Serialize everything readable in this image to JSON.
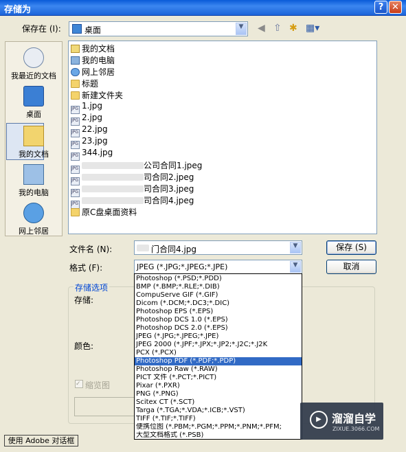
{
  "window": {
    "title": "存储为",
    "help": "?",
    "close": "✕"
  },
  "save_in": {
    "label": "保存在 (I):",
    "value": "桌面"
  },
  "toolbar": {
    "back": "◀",
    "up": "⇧",
    "new_folder": "✱",
    "views": "▦▾"
  },
  "places": [
    {
      "label": "我最近的文档",
      "icon": "recent-documents-icon"
    },
    {
      "label": "桌面",
      "icon": "desktop-icon"
    },
    {
      "label": "我的文档",
      "icon": "my-documents-icon"
    },
    {
      "label": "我的电脑",
      "icon": "my-computer-icon"
    },
    {
      "label": "网上邻居",
      "icon": "network-places-icon"
    }
  ],
  "files": [
    {
      "name": "我的文档",
      "type": "doc"
    },
    {
      "name": "我的电脑",
      "type": "pc"
    },
    {
      "name": "网上邻居",
      "type": "net"
    },
    {
      "name": "标题",
      "type": "folder"
    },
    {
      "name": "新建文件夹",
      "type": "folder"
    },
    {
      "name": "1.jpg",
      "type": "jpg"
    },
    {
      "name": "2.jpg",
      "type": "jpg"
    },
    {
      "name": "22.jpg",
      "type": "jpg"
    },
    {
      "name": "23.jpg",
      "type": "jpg"
    },
    {
      "name": "344.jpg",
      "type": "jpg"
    },
    {
      "name": "公司合同1.jpeg",
      "type": "jpg",
      "prefix_blurred": true
    },
    {
      "name": "司合同2.jpeg",
      "type": "jpg",
      "prefix_blurred": true
    },
    {
      "name": "司合同3.jpeg",
      "type": "jpg",
      "prefix_blurred": true
    },
    {
      "name": "司合同4.jpeg",
      "type": "jpg",
      "prefix_blurred": true
    },
    {
      "name": "原C盘桌面资料",
      "type": "folder"
    }
  ],
  "filename": {
    "label": "文件名 (N):",
    "value": "门合同4.jpg"
  },
  "format": {
    "label": "格式 (F):",
    "value": "JPEG (*.JPG;*.JPEG;*.JPE)",
    "options": [
      "Photoshop (*.PSD;*.PDD)",
      "BMP (*.BMP;*.RLE;*.DIB)",
      "CompuServe GIF (*.GIF)",
      "Dicom (*.DCM;*.DC3;*.DIC)",
      "Photoshop EPS (*.EPS)",
      "Photoshop DCS 1.0 (*.EPS)",
      "Photoshop DCS 2.0 (*.EPS)",
      "JPEG (*.JPG;*.JPEG;*.JPE)",
      "JPEG 2000 (*.JPF;*.JPX;*.JP2;*.J2C;*.J2K",
      "PCX (*.PCX)",
      "Photoshop PDF (*.PDF;*.PDP)",
      "Photoshop Raw (*.RAW)",
      "PICT 文件 (*.PCT;*.PICT)",
      "Pixar (*.PXR)",
      "PNG (*.PNG)",
      "Scitex CT (*.SCT)",
      "Targa (*.TGA;*.VDA;*.ICB;*.VST)",
      "TIFF (*.TIF;*.TIFF)",
      "便携位图 (*.PBM;*.PGM;*.PPM;*.PNM;*.PFM;",
      "大型文档格式 (*.PSB)"
    ],
    "selected_index": 10
  },
  "buttons": {
    "save": "保存 (S)",
    "cancel": "取消"
  },
  "options_group": {
    "title": "存储选项",
    "store": "存储:",
    "color": "颜色:",
    "thumbnail": "缩览图"
  },
  "footer": {
    "adobe_dialog": "使用 Adobe 对话框"
  },
  "watermark": {
    "name": "溜溜自学",
    "url": "ZIXUE.3066.COM"
  }
}
